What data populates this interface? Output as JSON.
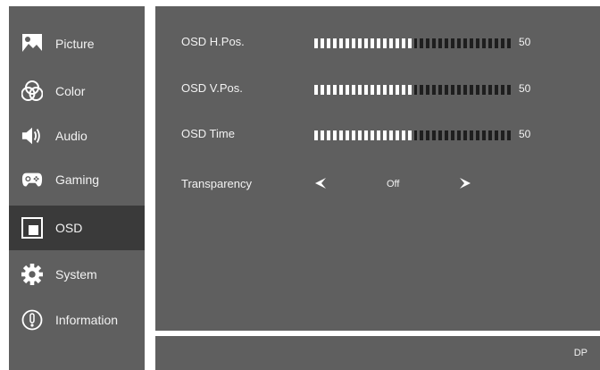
{
  "sidebar": {
    "items": [
      {
        "label": "Picture",
        "icon": "picture-icon"
      },
      {
        "label": "Color",
        "icon": "color-icon"
      },
      {
        "label": "Audio",
        "icon": "speaker-icon"
      },
      {
        "label": "Gaming",
        "icon": "gamepad-icon"
      },
      {
        "label": "OSD",
        "icon": "osd-icon",
        "active": true
      },
      {
        "label": "System",
        "icon": "gear-icon"
      },
      {
        "label": "Information",
        "icon": "info-icon"
      }
    ]
  },
  "osd": {
    "h_pos": {
      "label": "OSD H.Pos.",
      "value": "50",
      "level": 0.5
    },
    "v_pos": {
      "label": "OSD V.Pos.",
      "value": "50",
      "level": 0.5
    },
    "time": {
      "label": "OSD Time",
      "value": "50",
      "level": 0.5
    },
    "transparency": {
      "label": "Transparency",
      "value": "Off"
    }
  },
  "status": {
    "input": "DP"
  },
  "colors": {
    "panel": "#5f5f5f",
    "active": "#3a3a3a",
    "segment_on": "#ffffff",
    "segment_off": "#1e1e1e"
  }
}
